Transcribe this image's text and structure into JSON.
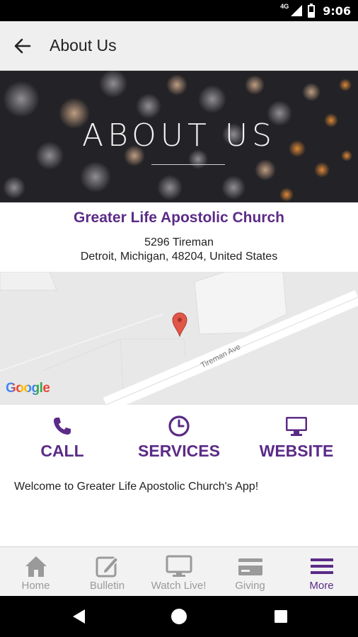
{
  "status_bar": {
    "time": "9:06",
    "network": "4G",
    "icons": [
      "signal-icon",
      "battery-icon"
    ]
  },
  "app_bar": {
    "title": "About Us",
    "back_icon": "arrow-left-icon"
  },
  "hero": {
    "title": "ABOUT US"
  },
  "church": {
    "name": "Greater Life Apostolic Church",
    "address_line1": "5296 Tireman",
    "address_line2": "Detroit, Michigan, 48204, United States"
  },
  "map": {
    "street_label": "Tireman Ave",
    "provider_logo": "Google",
    "marker_icon": "map-pin-icon"
  },
  "actions": [
    {
      "label": "CALL",
      "icon": "phone-icon"
    },
    {
      "label": "SERVICES",
      "icon": "clock-icon"
    },
    {
      "label": "WEBSITE",
      "icon": "monitor-icon"
    }
  ],
  "welcome_text": "Welcome to Greater Life Apostolic Church's App!",
  "bottom_nav": [
    {
      "label": "Home",
      "icon": "home-icon",
      "active": false
    },
    {
      "label": "Bulletin",
      "icon": "edit-icon",
      "active": false
    },
    {
      "label": "Watch Live!",
      "icon": "monitor-icon",
      "active": false
    },
    {
      "label": "Giving",
      "icon": "credit-card-icon",
      "active": false
    },
    {
      "label": "More",
      "icon": "menu-icon",
      "active": true
    }
  ],
  "colors": {
    "accent": "#5b2b87",
    "inactive": "#9a9a9a",
    "app_bar": "#efefef",
    "map_bg": "#e8e8e8",
    "pin": "#e0574a"
  }
}
